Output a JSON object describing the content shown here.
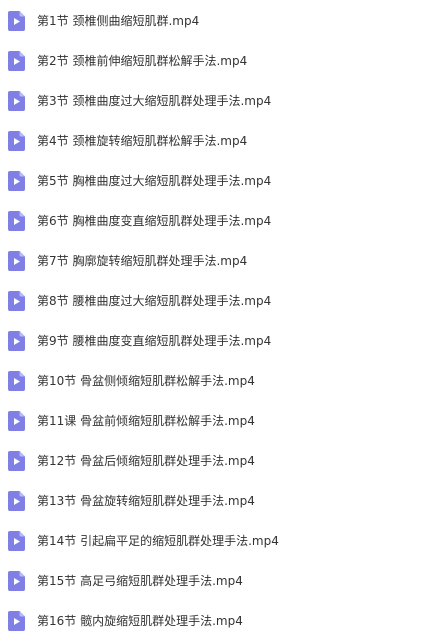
{
  "files": [
    {
      "name": "第1节 颈椎侧曲缩短肌群.mp4",
      "icon": "video-file-icon"
    },
    {
      "name": "第2节 颈椎前伸缩短肌群松解手法.mp4",
      "icon": "video-file-icon"
    },
    {
      "name": "第3节 颈椎曲度过大缩短肌群处理手法.mp4",
      "icon": "video-file-icon"
    },
    {
      "name": "第4节 颈椎旋转缩短肌群松解手法.mp4",
      "icon": "video-file-icon"
    },
    {
      "name": "第5节 胸椎曲度过大缩短肌群处理手法.mp4",
      "icon": "video-file-icon"
    },
    {
      "name": "第6节 胸椎曲度变直缩短肌群处理手法.mp4",
      "icon": "video-file-icon"
    },
    {
      "name": "第7节 胸廓旋转缩短肌群处理手法.mp4",
      "icon": "video-file-icon"
    },
    {
      "name": "第8节 腰椎曲度过大缩短肌群处理手法.mp4",
      "icon": "video-file-icon"
    },
    {
      "name": "第9节 腰椎曲度变直缩短肌群处理手法.mp4",
      "icon": "video-file-icon"
    },
    {
      "name": "第10节 骨盆侧倾缩短肌群松解手法.mp4",
      "icon": "video-file-icon"
    },
    {
      "name": "第11课 骨盆前倾缩短肌群松解手法.mp4",
      "icon": "video-file-icon"
    },
    {
      "name": "第12节 骨盆后倾缩短肌群处理手法.mp4",
      "icon": "video-file-icon"
    },
    {
      "name": "第13节 骨盆旋转缩短肌群处理手法.mp4",
      "icon": "video-file-icon"
    },
    {
      "name": "第14节 引起扁平足的缩短肌群处理手法.mp4",
      "icon": "video-file-icon"
    },
    {
      "name": "第15节 高足弓缩短肌群处理手法.mp4",
      "icon": "video-file-icon"
    },
    {
      "name": "第16节 髋内旋缩短肌群处理手法.mp4",
      "icon": "video-file-icon"
    }
  ],
  "colors": {
    "icon_fill": "#7f7fe6",
    "icon_fold": "#b9b9f5",
    "play_glyph": "#ffffff",
    "text": "#333333"
  }
}
